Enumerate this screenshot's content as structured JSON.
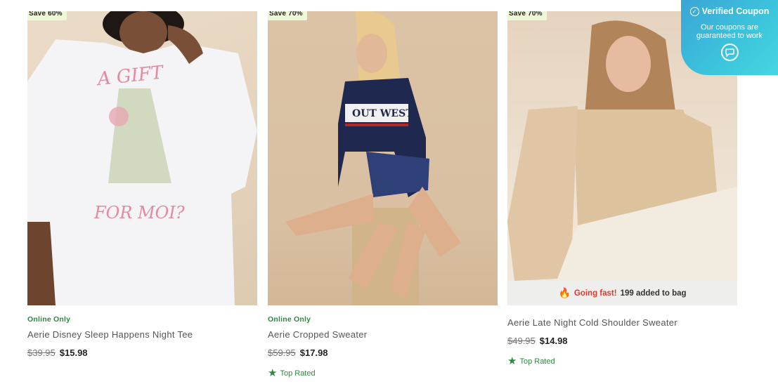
{
  "products": [
    {
      "badge": "Save 60%",
      "tag": "Online Only",
      "title": "Aerie Disney Sleep Happens Night Tee",
      "old_price": "$39.95",
      "new_price": "$15.98",
      "print_top": "A GIFT",
      "print_bottom": "FOR MOI?"
    },
    {
      "badge": "Save 70%",
      "tag": "Online Only",
      "title": "Aerie Cropped Sweater",
      "old_price": "$59.95",
      "new_price": "$17.98",
      "rating_label": "Top Rated",
      "sweater_print": "OUT WEST"
    },
    {
      "badge": "Save 70%",
      "title": "Aerie Late Night Cold Shoulder Sweater",
      "old_price": "$49.95",
      "new_price": "$14.98",
      "rating_label": "Top Rated",
      "urgency_label": "Going fast!",
      "urgency_text": "199 added to bag"
    }
  ],
  "coupon_widget": {
    "title": "Verified Coupon",
    "subtitle": "Our coupons are guaranteed to work",
    "accent_color": "#3cc5dc"
  },
  "colors": {
    "online_only": "#2d8a3e",
    "going_fast": "#e0382b",
    "badge_bg": "#f0f7d8"
  },
  "icons": [
    "star-icon",
    "flame-icon",
    "check-circle-icon",
    "chat-bubble-icon"
  ]
}
